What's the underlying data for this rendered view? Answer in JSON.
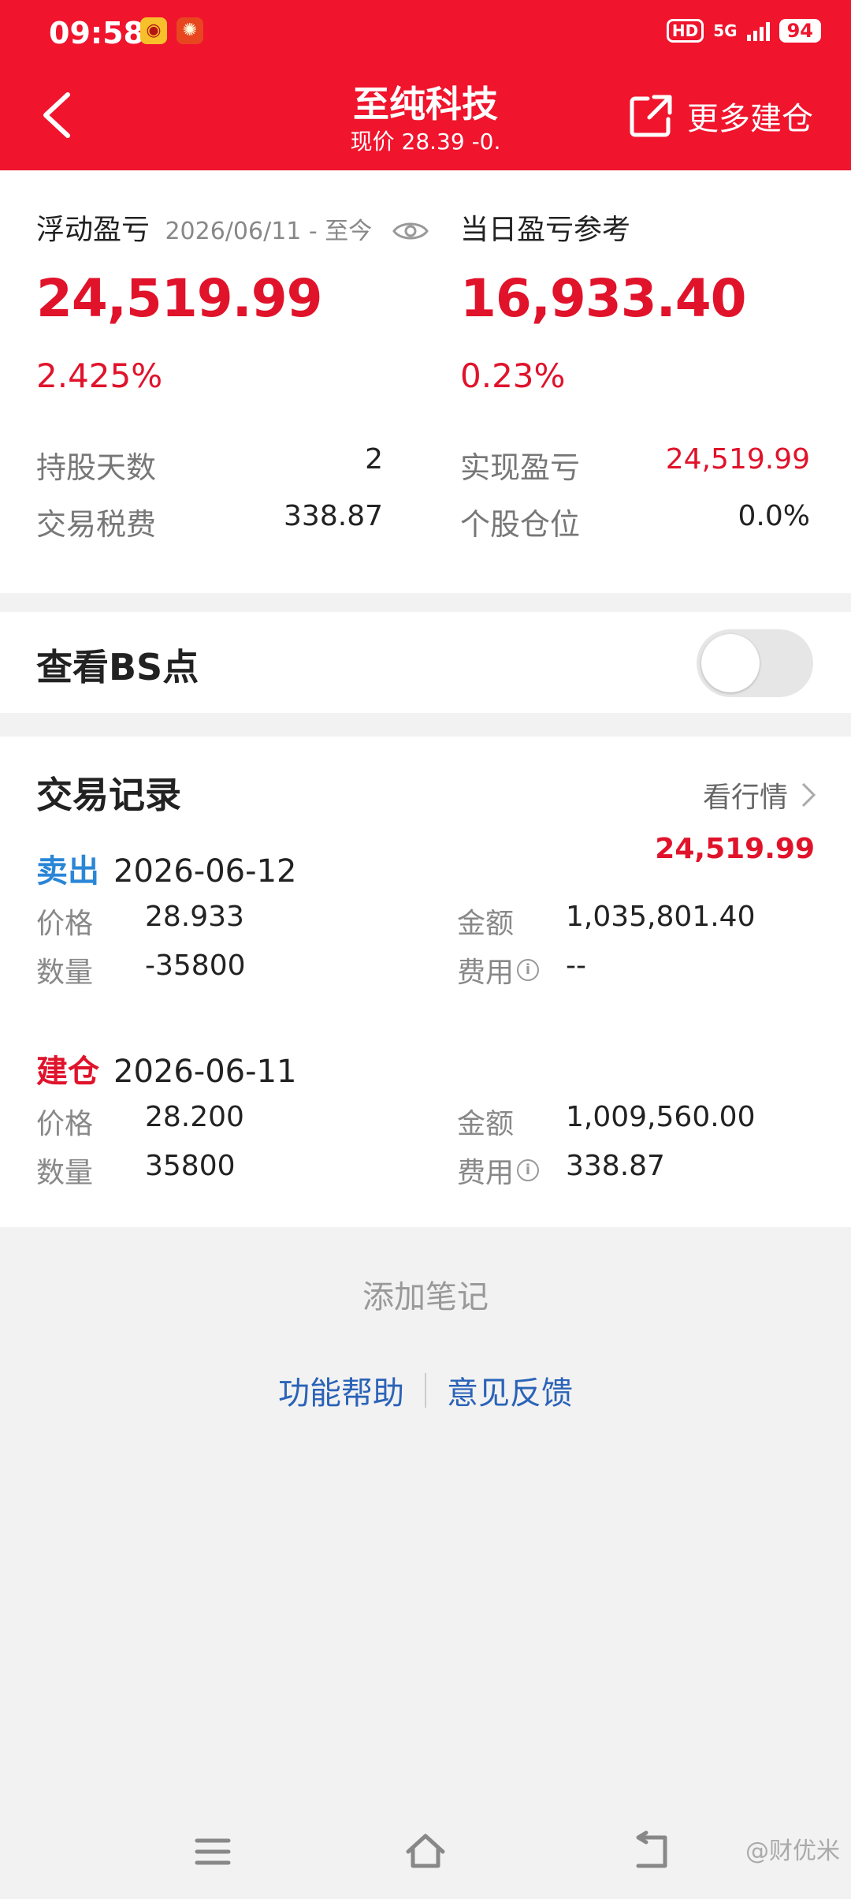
{
  "status_bar": {
    "time": "09:58",
    "hd_label": "HD",
    "network": "5G",
    "battery": "94"
  },
  "header": {
    "title": "至纯科技",
    "subtitle": "现价 28.39 -0.  ",
    "more_label": "更多建仓"
  },
  "summary": {
    "floating_label": "浮动盈亏",
    "date_range": "2026/06/11 - 至今",
    "floating_value": "24,519.99",
    "floating_pct": "2.425%",
    "daily_label": "当日盈亏参考",
    "daily_value": "16,933.40",
    "daily_pct": "0.23%",
    "hold_days_label": "持股天数",
    "hold_days": "2",
    "tax_label": "交易税费",
    "tax": "338.87",
    "realized_label": "实现盈亏",
    "realized": "24,519.99",
    "position_label": "个股仓位",
    "position": "0.0%"
  },
  "bs": {
    "label": "查看BS点"
  },
  "trades": {
    "title": "交易记录",
    "market_link": "看行情",
    "pnl": "24,519.99",
    "records": [
      {
        "type": "卖出",
        "date": "2026-06-12",
        "price_label": "价格",
        "price": "28.933",
        "amount_label": "金额",
        "amount": "1,035,801.40",
        "qty_label": "数量",
        "qty": "-35800",
        "fee_label": "费用",
        "fee": "--"
      },
      {
        "type": "建仓",
        "date": "2026-06-11",
        "price_label": "价格",
        "price": "28.200",
        "amount_label": "金额",
        "amount": "1,009,560.00",
        "qty_label": "数量",
        "qty": "35800",
        "fee_label": "费用",
        "fee": "338.87"
      }
    ]
  },
  "footer": {
    "add_note": "添加笔记",
    "help": "功能帮助",
    "feedback": "意见反馈"
  },
  "watermark": "@财优米",
  "colors": {
    "brand_red": "#f0142d",
    "profit_red": "#e0132b",
    "sell_blue": "#2a86d6",
    "link_blue": "#2b63b8"
  }
}
